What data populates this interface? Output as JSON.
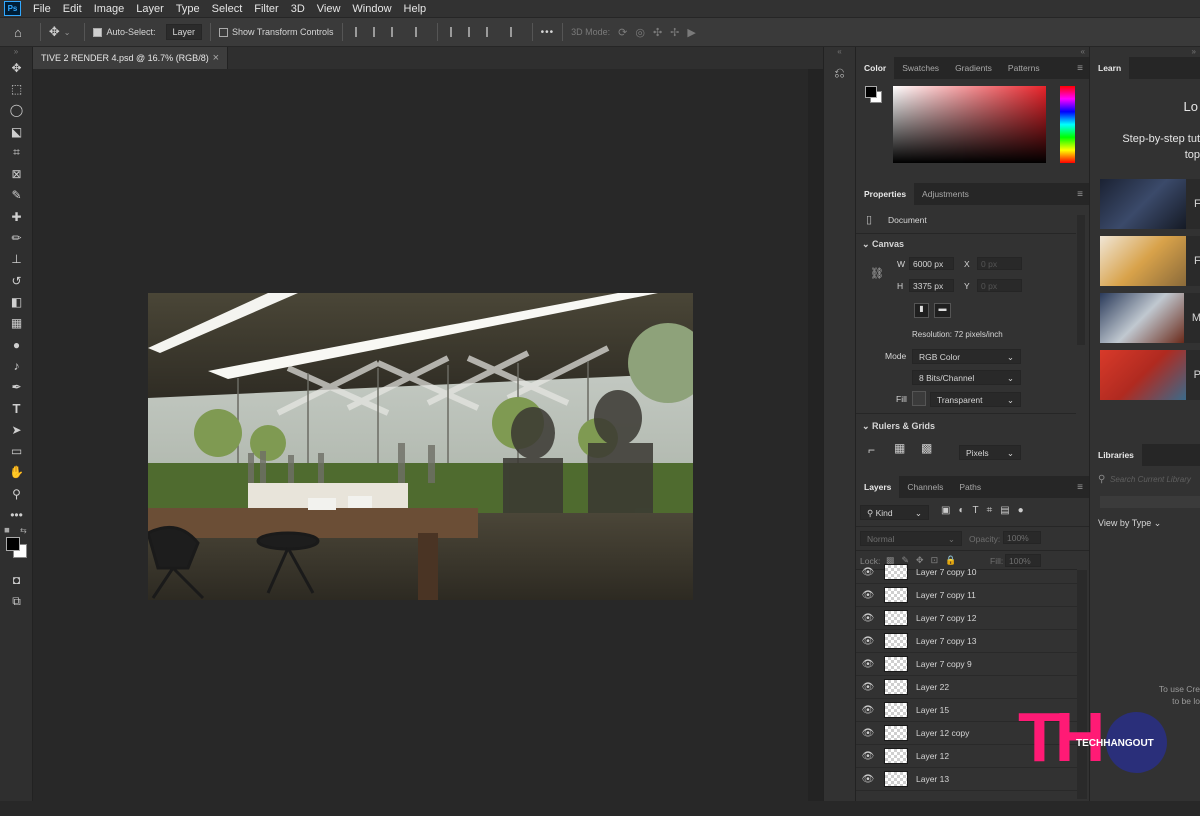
{
  "menu": [
    "File",
    "Edit",
    "Image",
    "Layer",
    "Type",
    "Select",
    "Filter",
    "3D",
    "View",
    "Window",
    "Help"
  ],
  "app_logo": "Ps",
  "options": {
    "auto_select_label": "Auto-Select:",
    "auto_select_value": "Layer",
    "show_transform": "Show Transform Controls",
    "mode_3d": "3D Mode:",
    "more": "•••"
  },
  "document_tab": {
    "title": "TIVE 2 RENDER 4.psd @ 16.7% (RGB/8)",
    "close": "×"
  },
  "color_panel": {
    "tabs": [
      "Color",
      "Swatches",
      "Gradients",
      "Patterns"
    ]
  },
  "properties": {
    "tabs": [
      "Properties",
      "Adjustments"
    ],
    "doc_label": "Document",
    "canvas_header": "Canvas",
    "w_label": "W",
    "w_value": "6000 px",
    "h_label": "H",
    "h_value": "3375 px",
    "x_label": "X",
    "x_placeholder": "0 px",
    "y_label": "Y",
    "y_placeholder": "0 px",
    "resolution": "Resolution: 72 pixels/inch",
    "mode_label": "Mode",
    "mode_value": "RGB Color",
    "bits_value": "8 Bits/Channel",
    "fill_label": "Fill",
    "fill_value": "Transparent",
    "rulers_header": "Rulers & Grids",
    "units_value": "Pixels"
  },
  "layers_panel": {
    "tabs": [
      "Layers",
      "Channels",
      "Paths"
    ],
    "kind_label": "Kind",
    "blend_mode": "Normal",
    "opacity_label": "Opacity:",
    "opacity_value": "100%",
    "lock_label": "Lock:",
    "fill_label": "Fill:",
    "fill_value": "100%",
    "layers": [
      "Layer 7 copy 10",
      "Layer 7 copy 11",
      "Layer 7 copy 12",
      "Layer 7 copy 13",
      "Layer 7 copy 9",
      "Layer 22",
      "Layer 15",
      "Layer 12 copy",
      "Layer 12",
      "Layer 13"
    ]
  },
  "learn_panel": {
    "tab": "Learn",
    "heading": "Lo",
    "subtext_1": "Step-by-step tut",
    "subtext_2": "top",
    "cards": [
      "F",
      "F",
      "M",
      "P"
    ]
  },
  "libraries_panel": {
    "tab": "Libraries",
    "search_placeholder": "Search Current Library",
    "view_by": "View by Type",
    "note_1": "To use Cre",
    "note_2": "to be lo"
  },
  "watermark": {
    "logo": "TH",
    "brand": "TECHHANGOUT",
    "colors": {
      "pink": "#ff1a75",
      "navy": "#2a2f7a"
    }
  }
}
